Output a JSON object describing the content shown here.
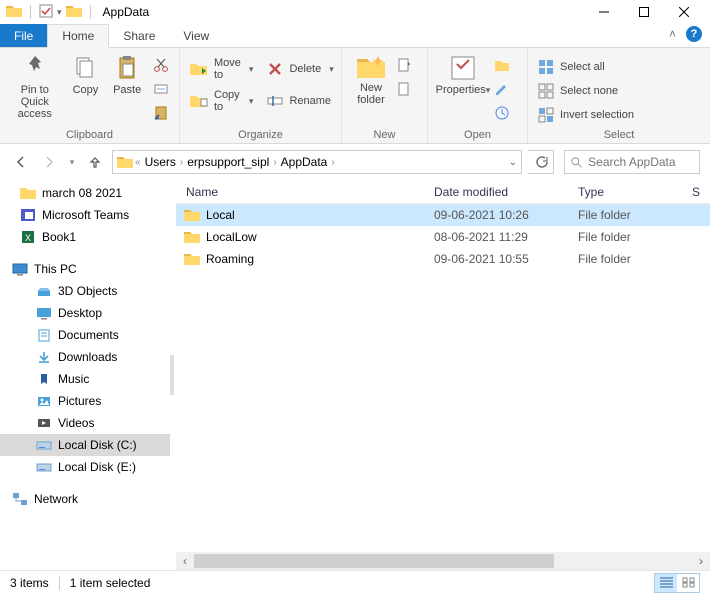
{
  "window": {
    "title": "AppData"
  },
  "tabs": {
    "file": "File",
    "home": "Home",
    "share": "Share",
    "view": "View"
  },
  "ribbon": {
    "clipboard": {
      "label": "Clipboard",
      "pin": "Pin to Quick\naccess",
      "copy": "Copy",
      "paste": "Paste"
    },
    "organize": {
      "label": "Organize",
      "move_to": "Move to",
      "copy_to": "Copy to",
      "delete": "Delete",
      "rename": "Rename"
    },
    "new": {
      "label": "New",
      "new_folder": "New\nfolder"
    },
    "open": {
      "label": "Open",
      "properties": "Properties"
    },
    "select": {
      "label": "Select",
      "select_all": "Select all",
      "select_none": "Select none",
      "invert": "Invert selection"
    }
  },
  "breadcrumbs": [
    "Users",
    "erpsupport_sipl",
    "AppData"
  ],
  "search": {
    "placeholder": "Search AppData"
  },
  "tree": {
    "quick": [
      "march 08 2021",
      "Microsoft Teams",
      "Book1"
    ],
    "this_pc": "This PC",
    "pc_children": [
      "3D Objects",
      "Desktop",
      "Documents",
      "Downloads",
      "Music",
      "Pictures",
      "Videos",
      "Local Disk (C:)",
      "Local Disk (E:)"
    ],
    "network": "Network"
  },
  "columns": {
    "name": "Name",
    "date": "Date modified",
    "type": "Type",
    "size": "S"
  },
  "rows": [
    {
      "name": "Local",
      "date": "09-06-2021 10:26",
      "type": "File folder",
      "selected": true
    },
    {
      "name": "LocalLow",
      "date": "08-06-2021 11:29",
      "type": "File folder",
      "selected": false
    },
    {
      "name": "Roaming",
      "date": "09-06-2021 10:55",
      "type": "File folder",
      "selected": false
    }
  ],
  "status": {
    "items": "3 items",
    "selected": "1 item selected"
  }
}
